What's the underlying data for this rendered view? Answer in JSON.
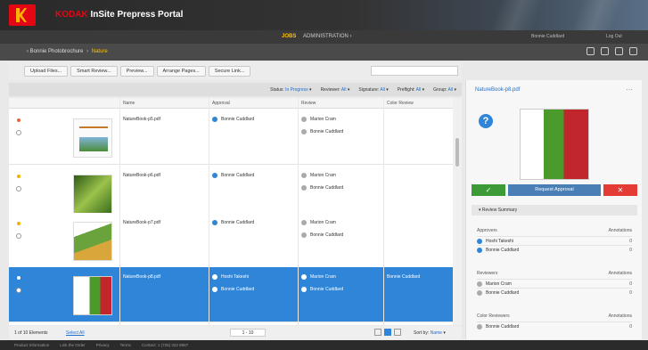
{
  "header": {
    "brand": "KODAK",
    "title": "InSite Prepress Portal"
  },
  "menu": {
    "jobs": "JOBS",
    "administration": "ADMINISTRATION ›",
    "user": "Bonnie Cuddlard",
    "logout": "Log Out"
  },
  "breadcrumb": {
    "parent": "Bonnie Photobrochure",
    "current": "Nature"
  },
  "toolbar": {
    "buttons": [
      "Upload Files...",
      "Smart Review...",
      "Preview...",
      "Arrange Pages...",
      "Secure Link..."
    ]
  },
  "filters": [
    {
      "label": "Status:",
      "value": "In Progress"
    },
    {
      "label": "Reviewer:",
      "value": "All"
    },
    {
      "label": "Signature:",
      "value": "All"
    },
    {
      "label": "Preflight:",
      "value": "All"
    },
    {
      "label": "Group:",
      "value": "All"
    }
  ],
  "grid": {
    "columns": [
      "Name",
      "Approval",
      "Review",
      "Color Review"
    ],
    "rows": [
      {
        "name": "NatureBook-p5.pdf",
        "approvers": [
          "Bonnie Cuddlard"
        ],
        "reviewers": [
          "Marion Cram",
          "Bonnie Cuddlard"
        ],
        "color_review": ""
      },
      {
        "name": "NatureBook-p6.pdf",
        "approvers": [
          "Bonnie Cuddlard"
        ],
        "reviewers": [
          "Marion Cram",
          "Bonnie Cuddlard"
        ],
        "color_review": ""
      },
      {
        "name": "NatureBook-p7.pdf",
        "approvers": [
          "Bonnie Cuddlard"
        ],
        "reviewers": [
          "Marion Cram",
          "Bonnie Cuddlard"
        ],
        "color_review": ""
      },
      {
        "name": "NatureBook-p8.pdf",
        "approvers": [
          "Hoshi Takeshi",
          "Bonnie Cuddlard"
        ],
        "reviewers": [
          "Marion Cram",
          "Bonnie Cuddlard"
        ],
        "color_review": "Bonnie Cuddlard"
      }
    ]
  },
  "pagination": {
    "count": "1 of 10 Elements",
    "select_all": "Select All",
    "page": "1 - 10",
    "sort_label": "Sort by:",
    "sort_value": "Name"
  },
  "footer": [
    "Product Information",
    "Link the Order",
    "Privacy",
    "Terms",
    "Contact: 1 (725) 322 8887"
  ],
  "panel": {
    "file": "NatureBook-p8.pdf",
    "help": "?",
    "approve": "✓",
    "request": "Request Approval",
    "reject": "✕",
    "section": "Review Summary",
    "groups": [
      {
        "title": "Approvers",
        "col": "Annotations",
        "items": [
          {
            "name": "Hoshi Takeshi",
            "count": "0"
          },
          {
            "name": "Bonnie Cuddlard",
            "count": "0"
          }
        ]
      },
      {
        "title": "Reviewers",
        "col": "Annotations",
        "items": [
          {
            "name": "Marion Cram",
            "count": "0"
          },
          {
            "name": "Bonnie Cuddlard",
            "count": "0"
          }
        ]
      },
      {
        "title": "Color Reviewers",
        "col": "Annotations",
        "items": [
          {
            "name": "Bonnie Cuddlard",
            "count": "0"
          }
        ]
      }
    ]
  },
  "colors": {
    "accent": "#2f86d8",
    "brand_red": "#e30613",
    "menu_active": "#ffc107",
    "approve_green": "#3c9a37",
    "reject_red": "#e53b35"
  }
}
